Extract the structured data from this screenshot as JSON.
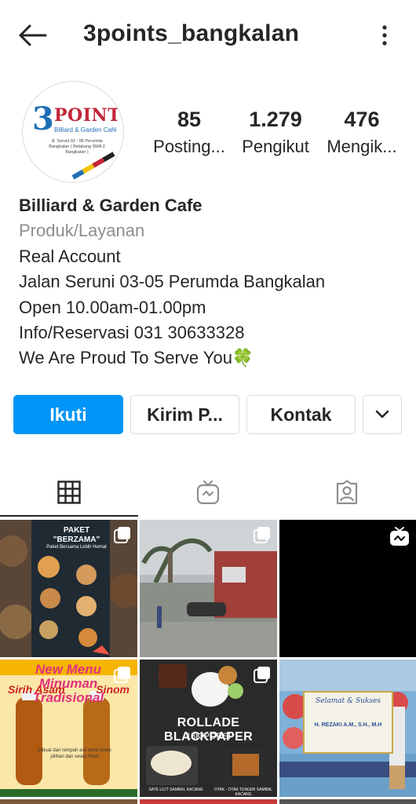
{
  "header": {
    "username": "3points_bangkalan",
    "back_icon": "arrow-left-icon",
    "more_icon": "vertical-dots-icon"
  },
  "avatar": {
    "logo_numeral": "3",
    "logo_word": "POINTS",
    "logo_tagline": "Billiard & Garden Café",
    "logo_address": "Jl. Seruni 03 - 05 Perumda Bangkalan ( Belakang SMA 2 Bangkalan )"
  },
  "stats": [
    {
      "value": "85",
      "label": "Posting..."
    },
    {
      "value": "1.279",
      "label": "Pengikut"
    },
    {
      "value": "476",
      "label": "Mengik..."
    }
  ],
  "bio": {
    "name": "Billiard & Garden Cafe",
    "category": "Produk/Layanan",
    "lines": [
      "Real Account",
      "Jalan Seruni 03-05 Perumda Bangkalan",
      "Open 10.00am-01.00pm",
      "Info/Reservasi 031 30633328",
      "We Are Proud To Serve You🍀"
    ]
  },
  "actions": {
    "follow": "Ikuti",
    "message": "Kirim P...",
    "contact": "Kontak",
    "more_icon": "chevron-down-icon"
  },
  "tabs": [
    {
      "icon": "grid-icon",
      "active": true
    },
    {
      "icon": "igtv-icon",
      "active": false
    },
    {
      "icon": "tagged-user-icon",
      "active": false
    }
  ],
  "posts": {
    "p1": {
      "title": "PAKET \"BERZAMA\"",
      "subtitle": "Paket Bersama Lebih Hemat"
    },
    "p4": {
      "headline": "New Menu Minuman Tradisional",
      "left": "Sirih Asam",
      "right": "Sinom",
      "note": "Dibuat dari rempah asli serta resep pilihan dan selalu fresh"
    },
    "p5": {
      "title": "ROLLADE BLACKPAPER",
      "price": "18K/PORSI",
      "cap_left": "SATE LILIT SAMBAL KACANG",
      "cap_right": "OTAK - OTAK TENGIRI SAMBAL KACANG"
    },
    "p6": {
      "greeting": "Selamat & Sukses",
      "name": "H. REZAKI A.M., S.H., M.H"
    }
  },
  "colors": {
    "accent": "#0095f6",
    "text": "#262626",
    "muted": "#8e8e8e",
    "border": "#dbdbdb"
  }
}
